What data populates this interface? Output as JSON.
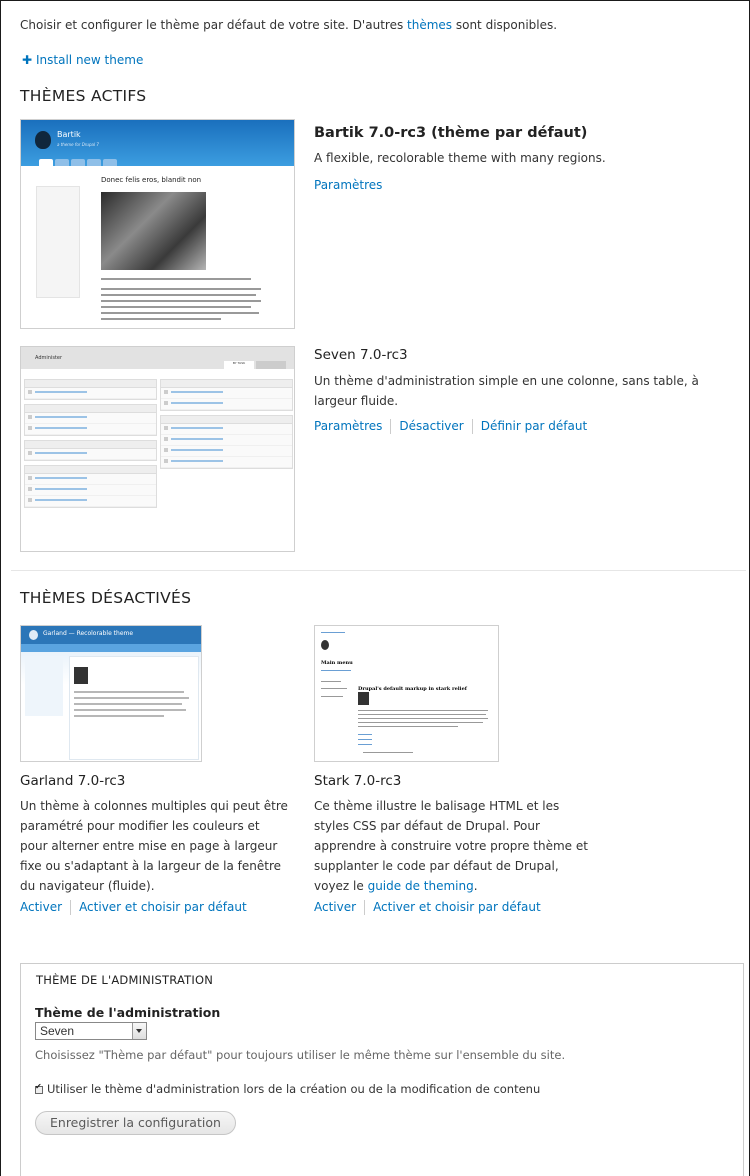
{
  "intro": {
    "text_before": "Choisir et configurer le thème par défaut de votre site. D'autres ",
    "link": "thèmes",
    "text_after": " sont disponibles."
  },
  "install_link": "Install new theme",
  "sections": {
    "enabled_title": "THÈMES ACTIFS",
    "disabled_title": "THÈMES DÉSACTIVÉS"
  },
  "enabled_themes": [
    {
      "title": "Bartik 7.0-rc3 (thème par défaut)",
      "description": "A flexible, recolorable theme with many regions.",
      "operations": [
        "Paramètres"
      ],
      "screenshot": {
        "site_name": "Bartik",
        "slogan": "a theme for Drupal 7",
        "node_title": "Donec felis eros, blandit non"
      }
    },
    {
      "title": "Seven 7.0-rc3",
      "description": "Un thème d'administration simple en une colonne, sans table, à largeur fluide.",
      "operations": [
        "Paramètres",
        "Désactiver",
        "Définir par défaut"
      ],
      "screenshot": {
        "page_title": "Administer",
        "tab": "BY TASK"
      }
    }
  ],
  "disabled_themes": [
    {
      "title": "Garland 7.0-rc3",
      "description": "Un thème à colonnes multiples qui peut être paramétré pour modifier les couleurs et pour alterner entre mise en page à largeur fixe ou s'adaptant à la largeur de la fenêtre du navigateur (fluide).",
      "operations": [
        "Activer",
        "Activer et choisir par défaut"
      ],
      "screenshot": {
        "site_name": "Garland — Recolorable theme"
      }
    },
    {
      "title": "Stark 7.0-rc3",
      "description_before": "Ce thème illustre le balisage HTML et les styles CSS par défaut de Drupal. Pour apprendre à construire votre propre thème et supplanter le code par défaut de Drupal, voyez le ",
      "description_link": "guide de theming",
      "description_after": ".",
      "operations": [
        "Activer",
        "Activer et choisir par défaut"
      ],
      "screenshot": {
        "menu_title": "Main menu",
        "heading": "Drupal's default markup in stark relief"
      }
    }
  ],
  "admin_theme": {
    "legend": "THÈME DE L'ADMINISTRATION",
    "label": "Thème de l'administration",
    "selected": "Seven",
    "help": "Choisissez \"Thème par défaut\" pour toujours utiliser le même thème sur l'ensemble du site.",
    "checkbox_checked": true,
    "checkbox_label": "Utiliser le thème d'administration lors de la création ou de la modification de contenu",
    "save_button": "Enregistrer la configuration"
  },
  "colors": {
    "link": "#0074bd",
    "text": "#333333",
    "bartik_header": "#2a85cf",
    "garland_header": "#2b76b8"
  }
}
